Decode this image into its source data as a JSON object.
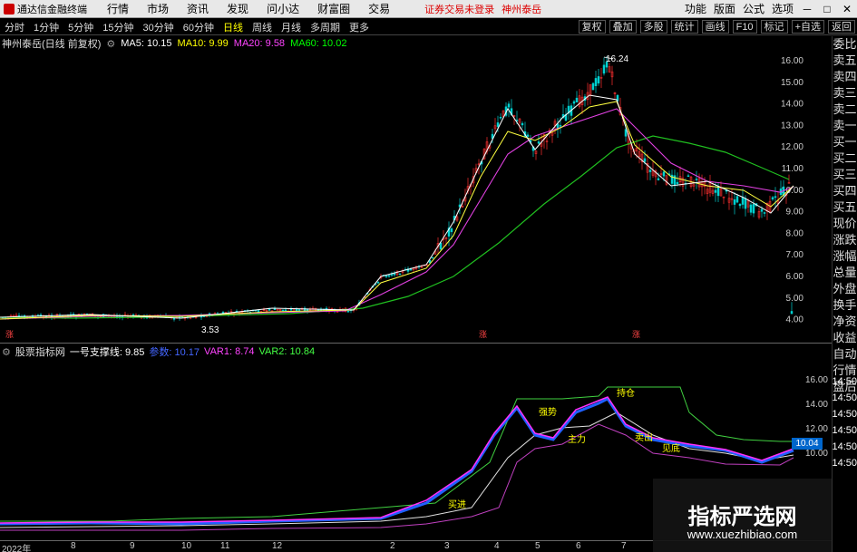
{
  "menubar": {
    "app_title": "通达信金融终端",
    "items": [
      "行情",
      "市场",
      "资讯",
      "发现",
      "问小达",
      "财富圈",
      "交易"
    ],
    "alert": "证券交易未登录",
    "stock_name": "神州泰岳",
    "right_items": [
      "功能",
      "版面",
      "公式",
      "选项"
    ],
    "window_controls": [
      "─",
      "□",
      "✕"
    ]
  },
  "periodbar": {
    "periods": [
      "分时",
      "1分钟",
      "5分钟",
      "15分钟",
      "30分钟",
      "60分钟",
      "日线",
      "周线",
      "月线",
      "多周期",
      "更多"
    ],
    "active": "日线",
    "right_buttons": [
      "复权",
      "叠加",
      "多股",
      "统计",
      "画线",
      "F10",
      "标记",
      "+自选",
      "返回"
    ]
  },
  "ma_line": {
    "title": "神州泰岳(日线 前复权)",
    "ma5": "MA5: 10.15",
    "ma10": "MA10: 9.99",
    "ma20": "MA20: 9.58",
    "ma60": "MA60: 10.02"
  },
  "sidebar": {
    "items": [
      "委比",
      "卖五",
      "卖四",
      "卖三",
      "卖二",
      "卖一",
      "买一",
      "买二",
      "买三",
      "买四",
      "买五",
      "现价",
      "涨跌",
      "涨幅",
      "总量",
      "外盘",
      "换手",
      "净资",
      "收益",
      "自动",
      "行情",
      "盘后"
    ],
    "lower_prices": [
      "14:50",
      "14:50",
      "14:50",
      "14:50",
      "14:50",
      "14:50"
    ]
  },
  "price_axis_top": [
    "16.00",
    "15.00",
    "14.00",
    "13.00",
    "12.00",
    "11.00",
    "10.00",
    "9.00",
    "8.00",
    "7.00",
    "6.00",
    "5.00",
    "4.00"
  ],
  "price_axis_bottom": [
    "16.00",
    "14.00",
    "12.00",
    "10.00"
  ],
  "annotations": {
    "high": "16.24",
    "low": "3.53",
    "marker1": "涨",
    "marker2": "涨",
    "marker3": "涨"
  },
  "indicator_line": {
    "title": "股票指标网",
    "name": "一号支撑线: 9.85",
    "var0": "参数: 10.17",
    "var1": "VAR1: 8.74",
    "var2": "VAR2: 10.84"
  },
  "signals": {
    "buy": "买进",
    "sell": "卖出",
    "bottom": "见底",
    "hold": "持仓",
    "strong": "强势",
    "main": "主力"
  },
  "current_price_tag": "10.04",
  "dates": [
    "2022年",
    "8",
    "9",
    "10",
    "11",
    "12",
    "2",
    "3",
    "4",
    "5",
    "6",
    "7"
  ],
  "watermark": {
    "title": "指标严选网",
    "url": "www.xuezhibiao.com"
  },
  "colors": {
    "up": "#ff3030",
    "down": "#00d0d0",
    "ma5": "#ffffff",
    "ma10": "#ffff00",
    "ma20": "#ff40ff",
    "ma60": "#00ff00"
  }
}
